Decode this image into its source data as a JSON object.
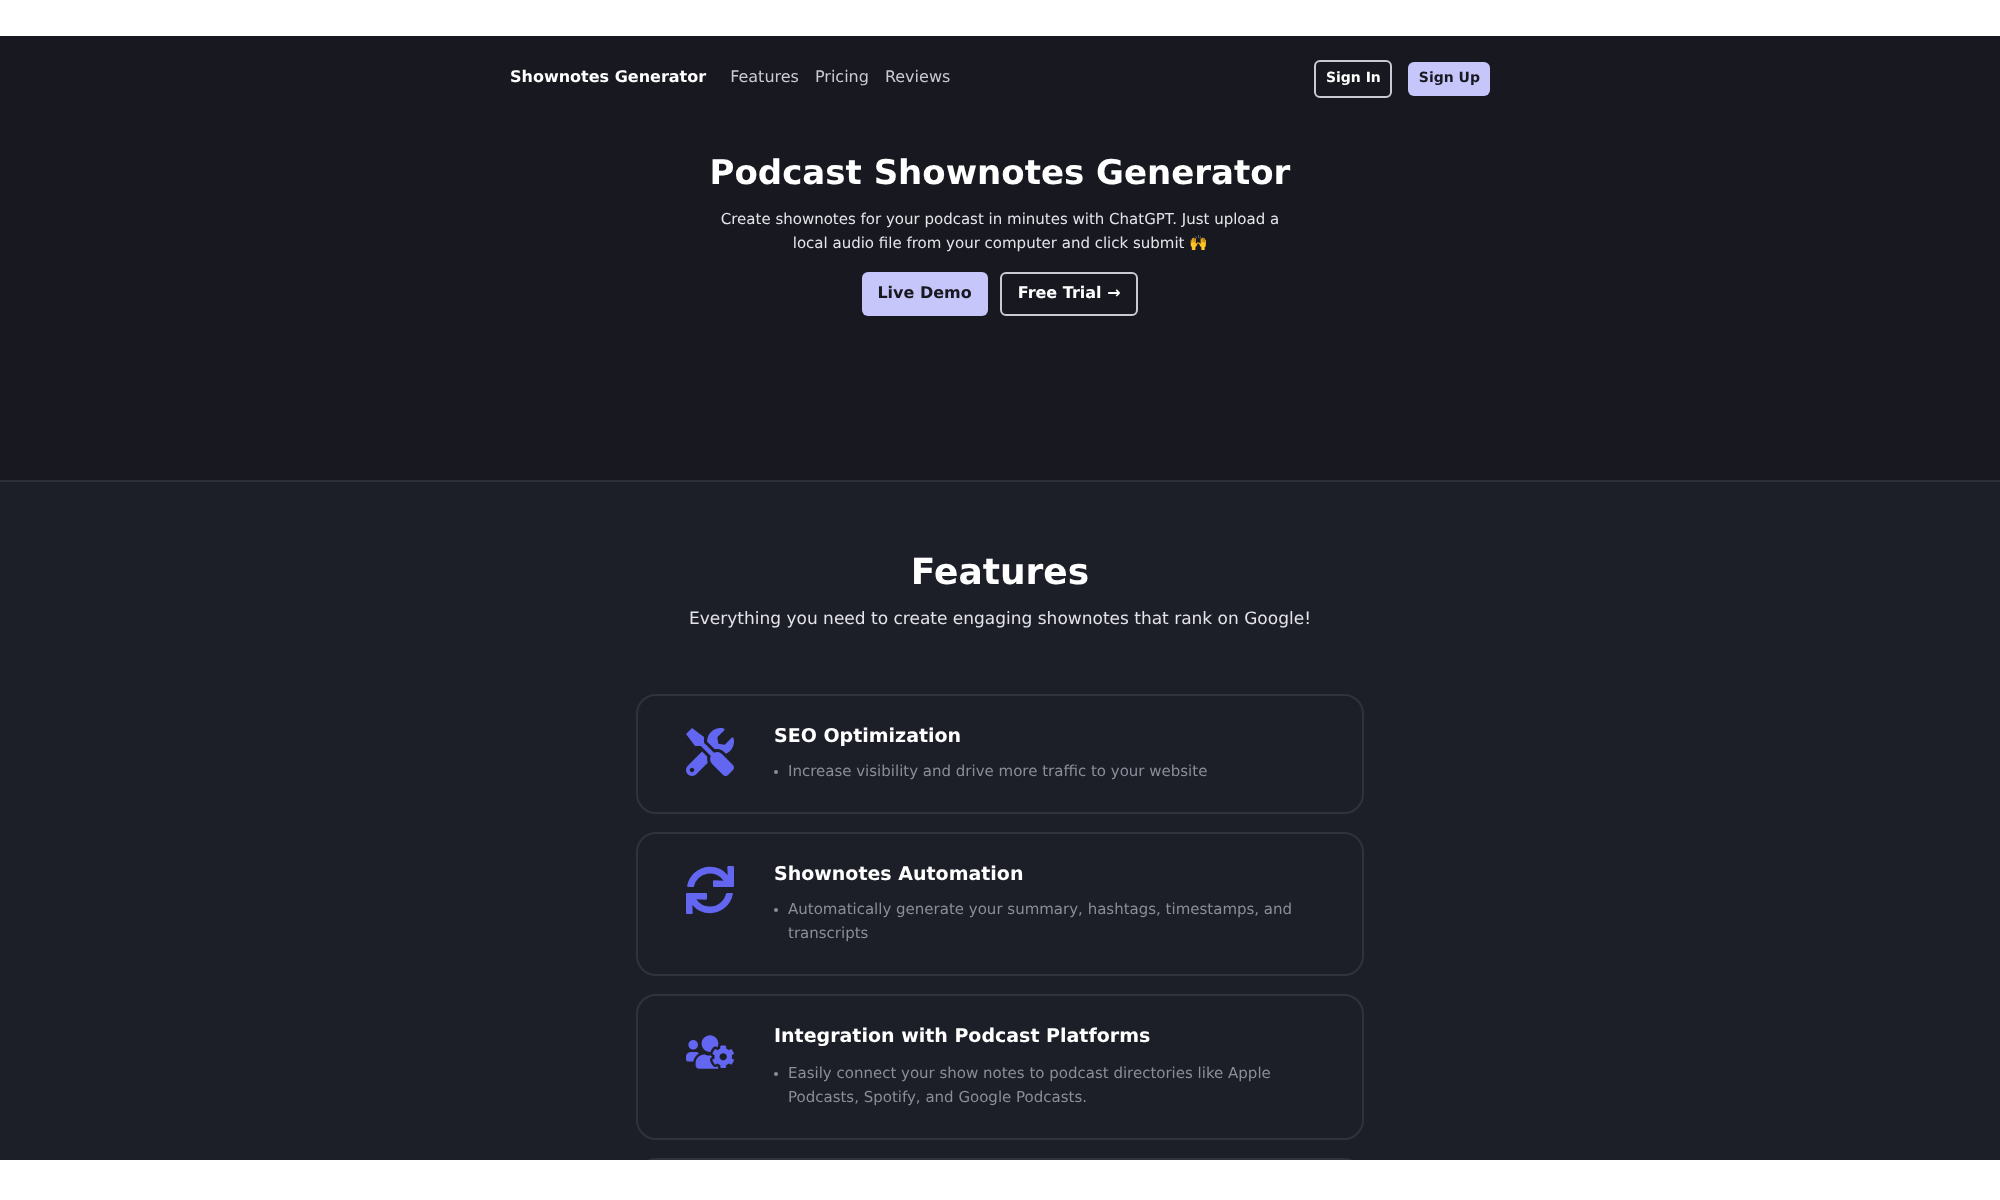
{
  "nav": {
    "brand": "Shownotes Generator",
    "links": [
      "Features",
      "Pricing",
      "Reviews"
    ],
    "sign_in": "Sign In",
    "sign_up": "Sign Up"
  },
  "hero": {
    "title": "Podcast Shownotes Generator",
    "text": "Create shownotes for your podcast in minutes with ChatGPT. Just upload a local audio file from your computer and click submit 🙌",
    "primary_button": "Live Demo",
    "secondary_button": "Free Trial →"
  },
  "features": {
    "title": "Features",
    "subtitle": "Everything you need to create engaging shownotes that rank on Google!",
    "items": [
      {
        "kind": "tools",
        "title": "SEO Optimization",
        "bullet": "Increase visibility and drive more traffic to your website"
      },
      {
        "kind": "sync",
        "title": "Shownotes Automation",
        "bullet": "Automatically generate your summary, hashtags, timestamps, and transcripts"
      },
      {
        "kind": "users",
        "title": "Integration with Podcast Platforms",
        "bullet": "Easily connect your show notes to podcast directories like Apple Podcasts, Spotify, and Google Podcasts."
      }
    ]
  }
}
